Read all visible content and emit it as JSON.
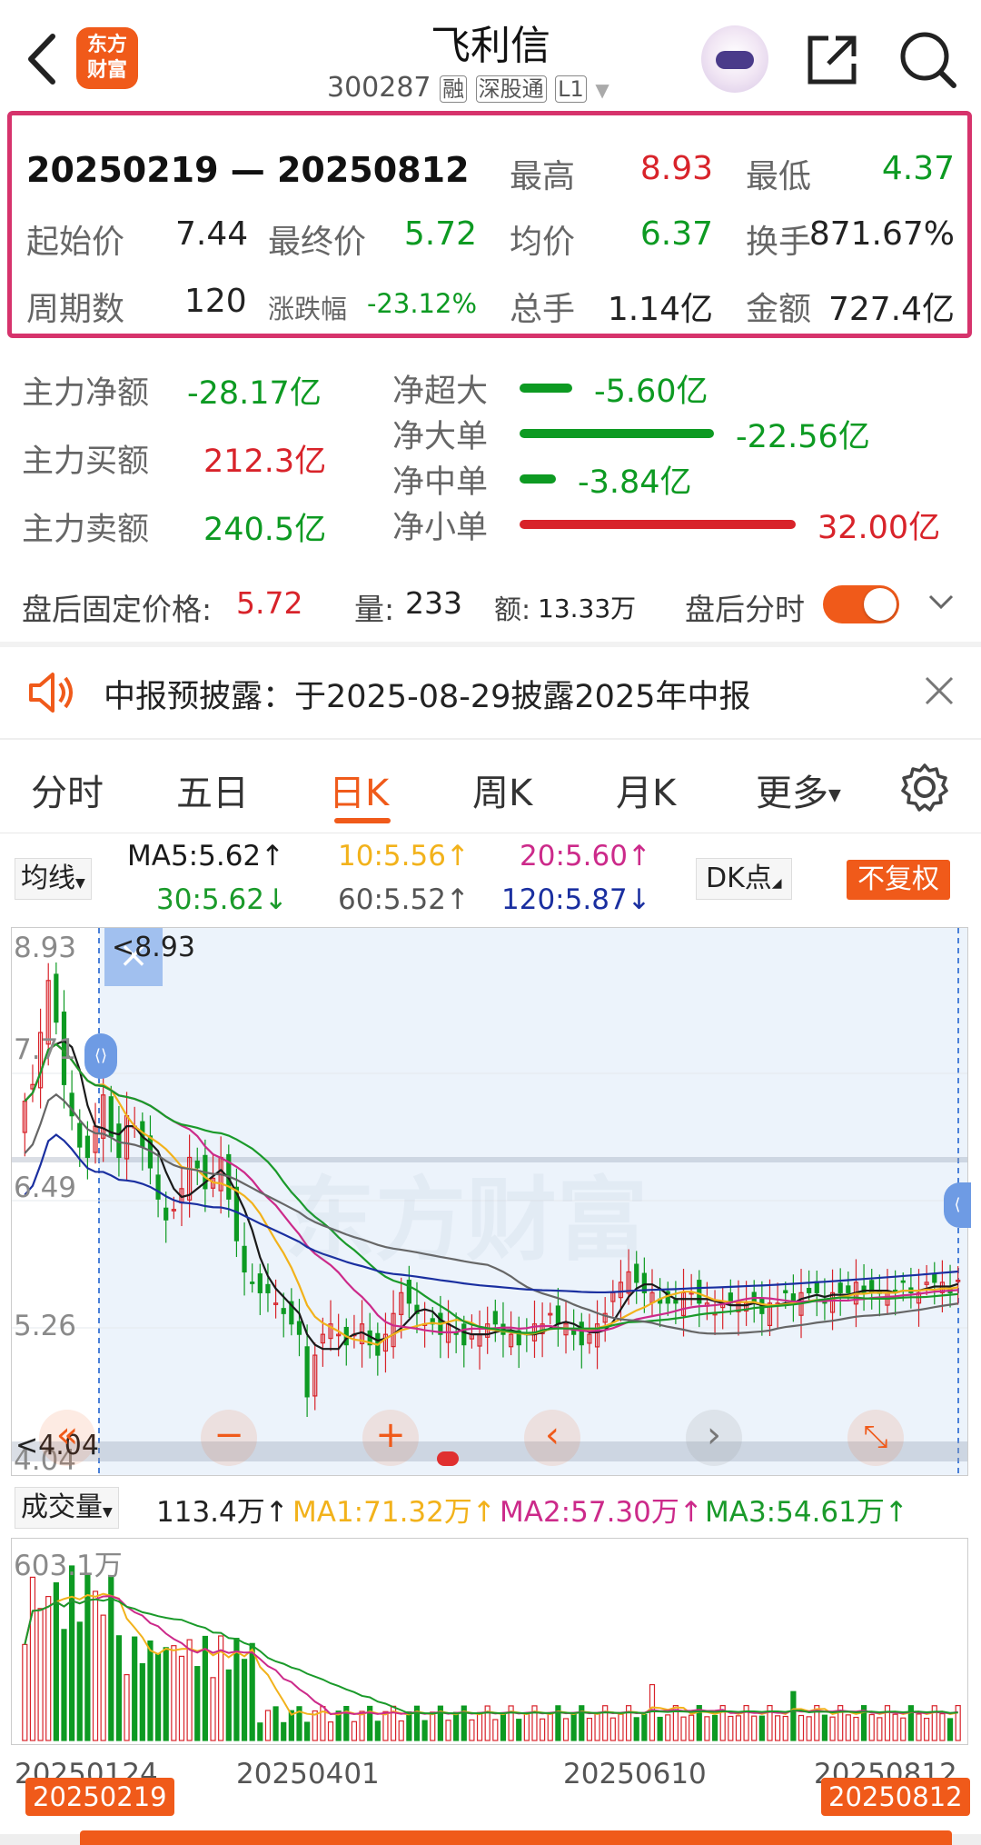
{
  "header": {
    "back_icon": "chevron-left-icon",
    "logo_text_1": "东方",
    "logo_text_2": "财富",
    "title": "飞利信",
    "code": "300287",
    "tag_rong": "融",
    "tag_sgt": "深股通",
    "tag_l1": "L1",
    "share_icon": "share-icon",
    "search_icon": "search-icon"
  },
  "range_stats": {
    "date_range": "20250219 — 20250812",
    "high_label": "最高",
    "high": "8.93",
    "low_label": "最低",
    "low": "4.37",
    "open_label": "起始价",
    "open": "7.44",
    "close_label": "最终价",
    "close": "5.72",
    "avg_label": "均价",
    "avg": "6.37",
    "turnover_label": "换手",
    "turnover": "871.67%",
    "periods_label": "周期数",
    "periods": "120",
    "change_label": "涨跌幅",
    "change": "-23.12%",
    "volume_label": "总手",
    "volume": "1.14亿",
    "amount_label": "金额",
    "amount": "727.4亿"
  },
  "fund_flow": {
    "net_label": "主力净额",
    "net": "-28.17亿",
    "buy_label": "主力买额",
    "buy": "212.3亿",
    "sell_label": "主力卖额",
    "sell": "240.5亿",
    "xl_label": "净超大",
    "xl": "-5.60亿",
    "xl_value": -5.6,
    "l_label": "净大单",
    "l": "-22.56亿",
    "l_value": -22.56,
    "m_label": "净中单",
    "m": "-3.84亿",
    "m_value": -3.84,
    "s_label": "净小单",
    "s": "32.00亿",
    "s_value": 32.0
  },
  "after_hours": {
    "price_label": "盘后固定价格:",
    "price": "5.72",
    "vol_label": "量:",
    "vol": "233",
    "amt_label": "额:",
    "amt": "13.33万",
    "toggle_label": "盘后分时",
    "toggle_on": true
  },
  "notice": {
    "text": "中报预披露：于2025-08-29披露2025年中报"
  },
  "tabs": [
    "分时",
    "五日",
    "日K",
    "周K",
    "月K",
    "更多"
  ],
  "active_tab": "日K",
  "ma_bar": {
    "selector": "均线",
    "ma5": "MA5:5.62↑",
    "ma10": "10:5.56↑",
    "ma20": "20:5.60↑",
    "ma30": "30:5.62↓",
    "ma60": "60:5.52↑",
    "ma120": "120:5.87↓",
    "dk_label": "DK点",
    "adjust_label": "不复权"
  },
  "price_axis": [
    "8.93",
    "7.71",
    "6.49",
    "5.26",
    "4.04"
  ],
  "price_marker_high": "8.93",
  "price_marker_low": "4.04",
  "chart_controls": [
    "«",
    "−",
    "+",
    "‹",
    "›",
    "⤡"
  ],
  "volume_bar": {
    "selector": "成交量",
    "vol": "113.4万↑",
    "ma1": "MA1:71.32万↑",
    "ma2": "MA2:57.30万↑",
    "ma3": "MA3:54.61万↑",
    "max_label": "603.1万"
  },
  "date_axis": [
    "20250124",
    "20250401",
    "20250610",
    "20250812"
  ],
  "range_start": "20250219",
  "range_end": "20250812",
  "colors": {
    "up": "#d8232a",
    "down": "#0d9a22",
    "accent": "#f05a1a",
    "highlight_border": "#d6336c",
    "ma5": "#1a1a1a",
    "ma10": "#f2b21b",
    "ma20": "#cc2a8a",
    "ma30": "#1a9a2a",
    "ma60": "#666666",
    "ma120": "#1a2fa0"
  },
  "chart_data": {
    "type": "candlestick",
    "ylim": [
      4.04,
      8.93
    ],
    "close_approx": [
      7.44,
      7.6,
      8.1,
      8.6,
      8.2,
      7.6,
      7.3,
      7.0,
      6.9,
      7.2,
      7.5,
      7.1,
      6.9,
      7.3,
      7.2,
      7.0,
      6.8,
      6.5,
      6.3,
      6.4,
      6.6,
      6.9,
      6.8,
      6.6,
      6.7,
      6.9,
      6.5,
      6.1,
      5.8,
      5.7,
      5.6,
      5.6,
      5.5,
      5.4,
      5.3,
      5.2,
      4.6,
      5.0,
      5.2,
      5.3,
      5.2,
      5.1,
      5.2,
      5.3,
      5.1,
      5.0,
      5.2,
      5.4,
      5.6,
      5.5,
      5.4,
      5.3,
      5.3,
      5.2,
      5.3,
      5.2,
      5.1,
      5.2,
      5.2,
      5.3,
      5.3,
      5.2,
      5.2,
      5.1,
      5.2,
      5.3,
      5.3,
      5.4,
      5.3,
      5.3,
      5.2,
      5.1,
      5.2,
      5.3,
      5.4,
      5.6,
      5.7,
      5.8,
      5.7,
      5.6,
      5.6,
      5.5,
      5.5,
      5.5,
      5.6,
      5.6,
      5.5,
      5.5,
      5.4,
      5.5,
      5.5,
      5.5,
      5.5,
      5.5,
      5.4,
      5.5,
      5.5,
      5.6,
      5.5,
      5.6,
      5.6,
      5.6,
      5.5,
      5.6,
      5.6,
      5.6,
      5.7,
      5.6,
      5.6,
      5.6,
      5.6,
      5.6,
      5.7,
      5.6,
      5.6,
      5.7,
      5.7,
      5.7,
      5.6,
      5.72
    ],
    "volume_max": "603.1万"
  }
}
